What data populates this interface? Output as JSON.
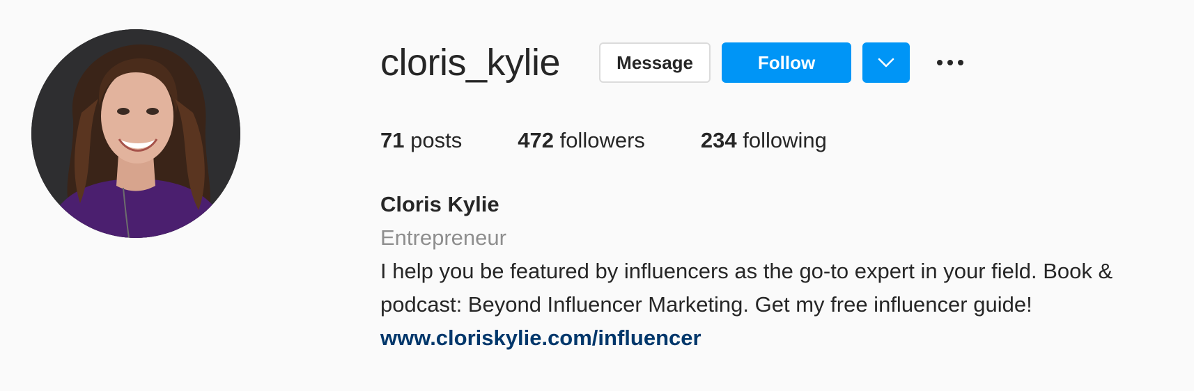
{
  "profile": {
    "username": "cloris_kylie",
    "full_name": "Cloris Kylie",
    "category": "Entrepreneur",
    "bio_line1": "I help you be featured by influencers as the go-to expert in your field. Book &",
    "bio_line2": "podcast: Beyond Influencer Marketing. Get my free influencer guide!",
    "website": "www.cloriskylie.com/influencer"
  },
  "actions": {
    "message_label": "Message",
    "follow_label": "Follow",
    "dropdown_icon": "chevron-down-icon",
    "more_icon": "more-options-icon"
  },
  "stats": {
    "posts_count": "71",
    "posts_label": "posts",
    "followers_count": "472",
    "followers_label": "followers",
    "following_count": "234",
    "following_label": "following"
  },
  "colors": {
    "accent": "#0095f6",
    "link": "#00376b",
    "secondary_text": "#8e8e8e",
    "background": "#fafafa"
  }
}
